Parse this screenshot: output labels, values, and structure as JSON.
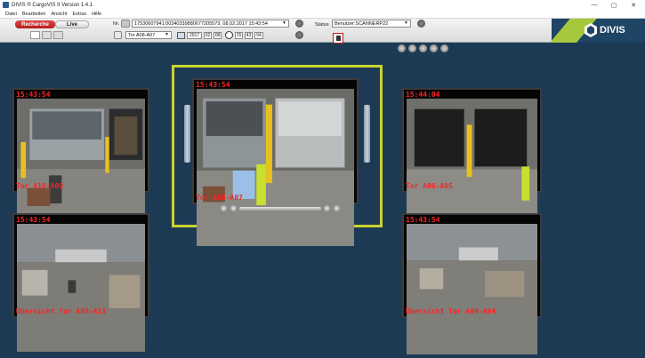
{
  "window": {
    "title": "DIVIS ® CargoVIS II Version 1.4.1",
    "controls": {
      "minimize": "—",
      "maximize": "▢",
      "close": "✕"
    }
  },
  "menu": [
    "Datei",
    "Bearbeiten",
    "Ansicht",
    "Extras",
    "Hilfe"
  ],
  "tabs": {
    "recherche": "Recherche",
    "live": "Live"
  },
  "search": {
    "nr_label": "Nr.",
    "nr_value": "17530607941;00340339880677205573, 08.02.2017 15:43:54",
    "gate_value": "Tor A08-A07",
    "date": {
      "year": "2017",
      "month": "02",
      "day": "08"
    },
    "time": {
      "hour": "15",
      "minute": "43",
      "second": "54"
    }
  },
  "status": {
    "label": "Status",
    "value": "Benutzer:SCANNERP22"
  },
  "logo": {
    "text": "DIVIS"
  },
  "cameras": {
    "top_left": {
      "time": "15:43:54",
      "name": "Tor A10-A09"
    },
    "center": {
      "time": "15:43:54",
      "name": "Tor A08-A07"
    },
    "top_right": {
      "time": "15:44:04",
      "name": "Tor A06-A05"
    },
    "bottom_left": {
      "time": "15:43:54",
      "name": "Übersicht Tor A08-A13"
    },
    "bottom_right": {
      "time": "15:43:54",
      "name": "Übersicht Tor A09-A04"
    }
  },
  "colors": {
    "background": "#1d3a55",
    "overlay_text": "#ff2222",
    "highlight": "#cbd32e",
    "tab_active": "#c82828",
    "logo_accent": "#a6c83c"
  }
}
